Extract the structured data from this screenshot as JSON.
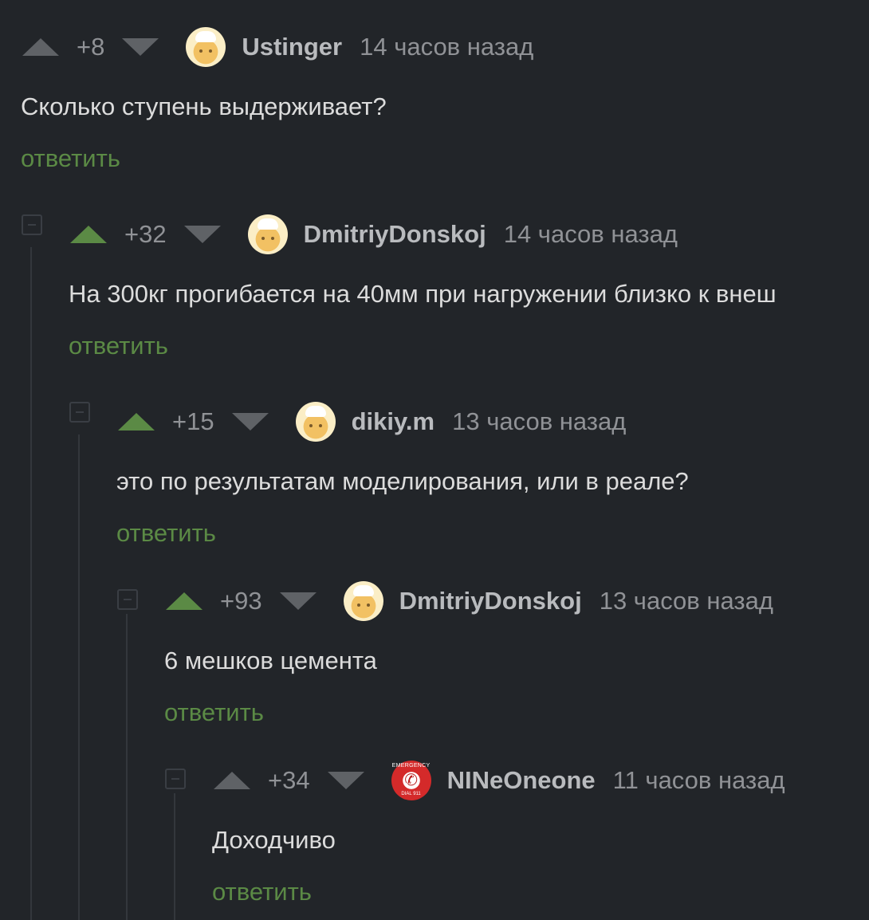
{
  "reply_label": "ответить",
  "comments": [
    {
      "rating": "+8",
      "user": "Ustinger",
      "time": "14 часов назад",
      "text": "Сколько ступень выдерживает?",
      "upvoted": false
    },
    {
      "rating": "+32",
      "user": "DmitriyDonskoj",
      "time": "14 часов назад",
      "text": "На 300кг прогибается на 40мм при нагружении близко к внеш",
      "upvoted": true
    },
    {
      "rating": "+15",
      "user": "dikiy.m",
      "time": "13 часов назад",
      "text": "это по результатам моделирования, или в реале?",
      "upvoted": true
    },
    {
      "rating": "+93",
      "user": "DmitriyDonskoj",
      "time": "13 часов назад",
      "text": "6 мешков цемента",
      "upvoted": true
    },
    {
      "rating": "+34",
      "user": "NINeOneone",
      "time": "11 часов назад",
      "text": "Доходчиво",
      "upvoted": false
    }
  ],
  "avatar_badge": {
    "top": "EMERGENCY",
    "bottom": "DIAL 911"
  },
  "colors": {
    "background": "#222529",
    "accent_green": "#5b8a45",
    "muted": "#909296"
  }
}
